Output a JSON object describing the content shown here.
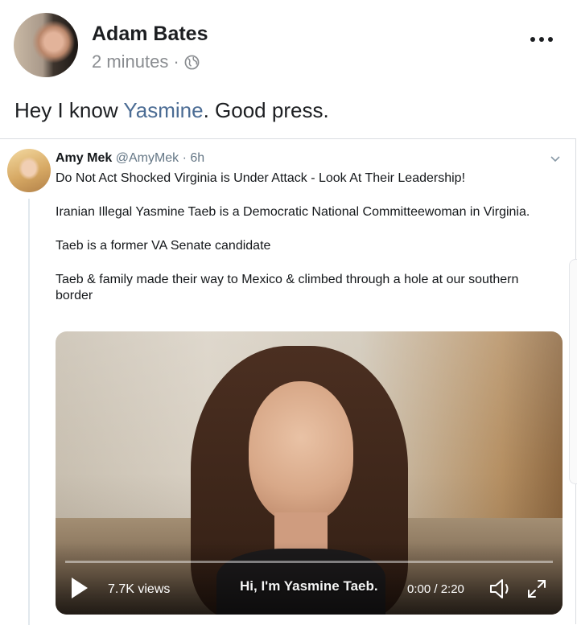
{
  "post": {
    "author": "Adam Bates",
    "time": "2 minutes",
    "separator": "·",
    "privacy_icon": "globe-icon",
    "text_before": "Hey I know ",
    "mention": "Yasmine",
    "text_after": ". Good press.",
    "menu_icon": "more-options-icon"
  },
  "tweet": {
    "name": "Amy Mek",
    "handle": "@AmyMek",
    "time": "· 6h",
    "lines": [
      "Do Not Act Shocked Virginia is Under Attack - Look At Their Leadership!",
      "Iranian Illegal Yasmine Taeb is a Democratic National Committeewoman in Virginia.",
      "Taeb is a former VA Senate candidate",
      "Taeb & family made their way to Mexico & climbed through a hole at our southern border"
    ],
    "video": {
      "views": "7.7K views",
      "caption": "Hi, I'm Yasmine Taeb.",
      "time": "0:00 / 2:20"
    }
  },
  "colors": {
    "mention": "#4b6c94",
    "meta_gray": "#8a8d91",
    "tweet_gray": "#657786"
  }
}
